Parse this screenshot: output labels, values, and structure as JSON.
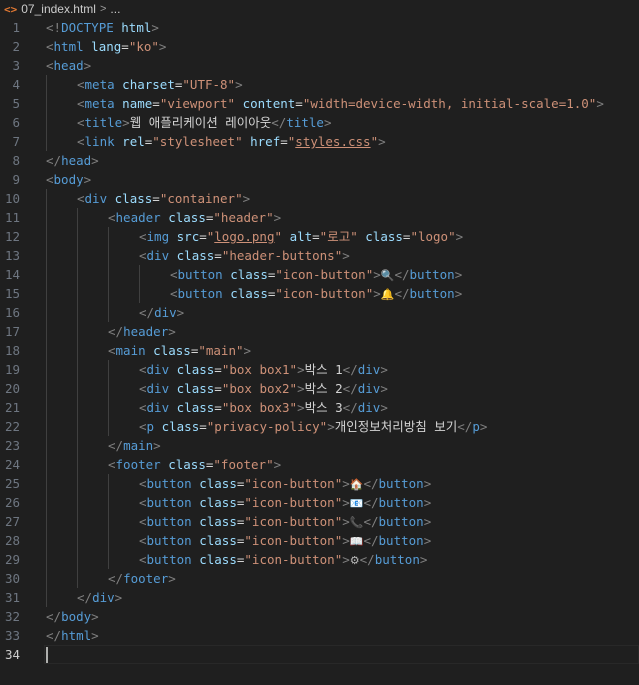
{
  "breadcrumb": {
    "file_icon": "<>",
    "file": "07_index.html",
    "separator": ">",
    "trail": "..."
  },
  "lines": [
    {
      "n": "1",
      "indent": 0,
      "html": "<span class='t'>&lt;!</span><span class='dt'>DOCTYPE</span> <span class='a'>html</span><span class='t'>&gt;</span>"
    },
    {
      "n": "2",
      "indent": 0,
      "html": "<span class='t'>&lt;</span><span class='n'>html</span> <span class='a'>lang</span><span class='x'>=</span><span class='v'>\"ko\"</span><span class='t'>&gt;</span>"
    },
    {
      "n": "3",
      "indent": 0,
      "html": "<span class='t'>&lt;</span><span class='n'>head</span><span class='t'>&gt;</span>"
    },
    {
      "n": "4",
      "indent": 1,
      "html": "<span class='t'>&lt;</span><span class='n'>meta</span> <span class='a'>charset</span><span class='x'>=</span><span class='v'>\"UTF-8\"</span><span class='t'>&gt;</span>"
    },
    {
      "n": "5",
      "indent": 1,
      "html": "<span class='t'>&lt;</span><span class='n'>meta</span> <span class='a'>name</span><span class='x'>=</span><span class='v'>\"viewport\"</span> <span class='a'>content</span><span class='x'>=</span><span class='v'>\"width=device-width, initial-scale=1.0\"</span><span class='t'>&gt;</span>"
    },
    {
      "n": "6",
      "indent": 1,
      "html": "<span class='t'>&lt;</span><span class='n'>title</span><span class='t'>&gt;</span><span class='x'>웹 애플리케이션 레이아웃</span><span class='t'>&lt;/</span><span class='n'>title</span><span class='t'>&gt;</span>"
    },
    {
      "n": "7",
      "indent": 1,
      "html": "<span class='t'>&lt;</span><span class='n'>link</span> <span class='a'>rel</span><span class='x'>=</span><span class='v'>\"stylesheet\"</span> <span class='a'>href</span><span class='x'>=</span><span class='v'>\"<span class='u'>styles.css</span>\"</span><span class='t'>&gt;</span>"
    },
    {
      "n": "8",
      "indent": 0,
      "html": "<span class='t'>&lt;/</span><span class='n'>head</span><span class='t'>&gt;</span>"
    },
    {
      "n": "9",
      "indent": 0,
      "html": "<span class='t'>&lt;</span><span class='n'>body</span><span class='t'>&gt;</span>"
    },
    {
      "n": "10",
      "indent": 1,
      "html": "<span class='t'>&lt;</span><span class='n'>div</span> <span class='a'>class</span><span class='x'>=</span><span class='v'>\"container\"</span><span class='t'>&gt;</span>"
    },
    {
      "n": "11",
      "indent": 2,
      "html": "<span class='t'>&lt;</span><span class='n'>header</span> <span class='a'>class</span><span class='x'>=</span><span class='v'>\"header\"</span><span class='t'>&gt;</span>"
    },
    {
      "n": "12",
      "indent": 3,
      "html": "<span class='t'>&lt;</span><span class='n'>img</span> <span class='a'>src</span><span class='x'>=</span><span class='v'>\"<span class='u'>logo.png</span>\"</span> <span class='a'>alt</span><span class='x'>=</span><span class='v'>\"로고\"</span> <span class='a'>class</span><span class='x'>=</span><span class='v'>\"logo\"</span><span class='t'>&gt;</span>"
    },
    {
      "n": "13",
      "indent": 3,
      "html": "<span class='t'>&lt;</span><span class='n'>div</span> <span class='a'>class</span><span class='x'>=</span><span class='v'>\"header-buttons\"</span><span class='t'>&gt;</span>"
    },
    {
      "n": "14",
      "indent": 4,
      "html": "<span class='t'>&lt;</span><span class='n'>button</span> <span class='a'>class</span><span class='x'>=</span><span class='v'>\"icon-button\"</span><span class='t'>&gt;</span><span class='emo' style='color:#4fa3e0'>🔍</span><span class='t'>&lt;/</span><span class='n'>button</span><span class='t'>&gt;</span>"
    },
    {
      "n": "15",
      "indent": 4,
      "html": "<span class='t'>&lt;</span><span class='n'>button</span> <span class='a'>class</span><span class='x'>=</span><span class='v'>\"icon-button\"</span><span class='t'>&gt;</span><span class='emo' style='color:#e8b923'>🔔</span><span class='t'>&lt;/</span><span class='n'>button</span><span class='t'>&gt;</span>"
    },
    {
      "n": "16",
      "indent": 3,
      "html": "<span class='t'>&lt;/</span><span class='n'>div</span><span class='t'>&gt;</span>"
    },
    {
      "n": "17",
      "indent": 2,
      "html": "<span class='t'>&lt;/</span><span class='n'>header</span><span class='t'>&gt;</span>"
    },
    {
      "n": "18",
      "indent": 2,
      "html": "<span class='t'>&lt;</span><span class='n'>main</span> <span class='a'>class</span><span class='x'>=</span><span class='v'>\"main\"</span><span class='t'>&gt;</span>"
    },
    {
      "n": "19",
      "indent": 3,
      "html": "<span class='t'>&lt;</span><span class='n'>div</span> <span class='a'>class</span><span class='x'>=</span><span class='v'>\"box box1\"</span><span class='t'>&gt;</span><span class='x'>박스 1</span><span class='t'>&lt;/</span><span class='n'>div</span><span class='t'>&gt;</span>"
    },
    {
      "n": "20",
      "indent": 3,
      "html": "<span class='t'>&lt;</span><span class='n'>div</span> <span class='a'>class</span><span class='x'>=</span><span class='v'>\"box box2\"</span><span class='t'>&gt;</span><span class='x'>박스 2</span><span class='t'>&lt;/</span><span class='n'>div</span><span class='t'>&gt;</span>"
    },
    {
      "n": "21",
      "indent": 3,
      "html": "<span class='t'>&lt;</span><span class='n'>div</span> <span class='a'>class</span><span class='x'>=</span><span class='v'>\"box box3\"</span><span class='t'>&gt;</span><span class='x'>박스 3</span><span class='t'>&lt;/</span><span class='n'>div</span><span class='t'>&gt;</span>"
    },
    {
      "n": "22",
      "indent": 3,
      "html": "<span class='t'>&lt;</span><span class='n'>p</span> <span class='a'>class</span><span class='x'>=</span><span class='v'>\"privacy-policy\"</span><span class='t'>&gt;</span><span class='x'>개인정보처리방침 보기</span><span class='t'>&lt;/</span><span class='n'>p</span><span class='t'>&gt;</span>"
    },
    {
      "n": "23",
      "indent": 2,
      "html": "<span class='t'>&lt;/</span><span class='n'>main</span><span class='t'>&gt;</span>"
    },
    {
      "n": "24",
      "indent": 2,
      "html": "<span class='t'>&lt;</span><span class='n'>footer</span> <span class='a'>class</span><span class='x'>=</span><span class='v'>\"footer\"</span><span class='t'>&gt;</span>"
    },
    {
      "n": "25",
      "indent": 3,
      "html": "<span class='t'>&lt;</span><span class='n'>button</span> <span class='a'>class</span><span class='x'>=</span><span class='v'>\"icon-button\"</span><span class='t'>&gt;</span><span class='emo' style='color:#e07b39'>🏠</span><span class='t'>&lt;/</span><span class='n'>button</span><span class='t'>&gt;</span>"
    },
    {
      "n": "26",
      "indent": 3,
      "html": "<span class='t'>&lt;</span><span class='n'>button</span> <span class='a'>class</span><span class='x'>=</span><span class='v'>\"icon-button\"</span><span class='t'>&gt;</span><span class='emo' style='color:#6fb3e6'>📧</span><span class='t'>&lt;/</span><span class='n'>button</span><span class='t'>&gt;</span>"
    },
    {
      "n": "27",
      "indent": 3,
      "html": "<span class='t'>&lt;</span><span class='n'>button</span> <span class='a'>class</span><span class='x'>=</span><span class='v'>\"icon-button\"</span><span class='t'>&gt;</span><span class='emo' style='color:#e0443b'>📞</span><span class='t'>&lt;/</span><span class='n'>button</span><span class='t'>&gt;</span>"
    },
    {
      "n": "28",
      "indent": 3,
      "html": "<span class='t'>&lt;</span><span class='n'>button</span> <span class='a'>class</span><span class='x'>=</span><span class='v'>\"icon-button\"</span><span class='t'>&gt;</span><span class='emo' style='color:#3fa9a0'>📖</span><span class='t'>&lt;/</span><span class='n'>button</span><span class='t'>&gt;</span>"
    },
    {
      "n": "29",
      "indent": 3,
      "html": "<span class='t'>&lt;</span><span class='n'>button</span> <span class='a'>class</span><span class='x'>=</span><span class='v'>\"icon-button\"</span><span class='t'>&gt;</span><span class='emo' style='color:#bbbbbb'>⚙</span><span class='t'>&lt;/</span><span class='n'>button</span><span class='t'>&gt;</span>"
    },
    {
      "n": "30",
      "indent": 2,
      "html": "<span class='t'>&lt;/</span><span class='n'>footer</span><span class='t'>&gt;</span>"
    },
    {
      "n": "31",
      "indent": 1,
      "html": "<span class='t'>&lt;/</span><span class='n'>div</span><span class='t'>&gt;</span>"
    },
    {
      "n": "32",
      "indent": 0,
      "html": "<span class='t'>&lt;/</span><span class='n'>body</span><span class='t'>&gt;</span>"
    },
    {
      "n": "33",
      "indent": 0,
      "html": "<span class='t'>&lt;/</span><span class='n'>html</span><span class='t'>&gt;</span>"
    },
    {
      "n": "34",
      "indent": 0,
      "html": "",
      "current": true
    }
  ]
}
